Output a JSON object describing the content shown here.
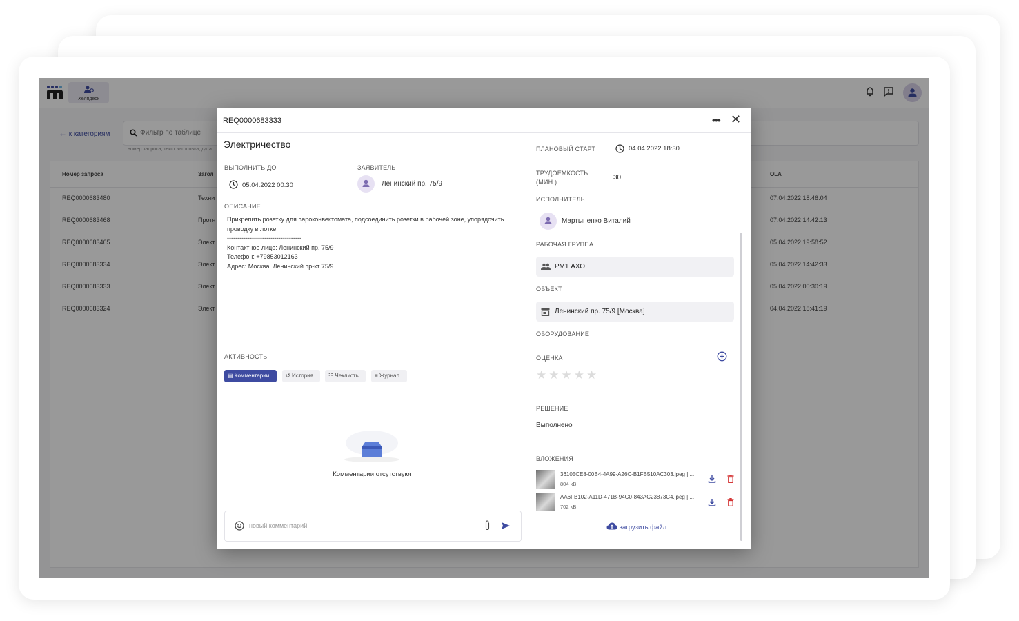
{
  "app": {
    "module_label": "Хелпдеск",
    "back_label": "к категориям",
    "filter_placeholder": "Фильтр по таблице",
    "filter_hint": "номер запроса, текст заголовка, дата",
    "accent_color": "#3e4ba1"
  },
  "table": {
    "columns": [
      "Номер запроса",
      "Загол",
      "OLA"
    ],
    "rows": [
      {
        "id": "REQ0000683480",
        "title": "Техни",
        "ola": "07.04.2022 18:46:04"
      },
      {
        "id": "REQ0000683468",
        "title": "Протя",
        "ola": "07.04.2022 14:42:13"
      },
      {
        "id": "REQ0000683465",
        "title": "Элект",
        "ola": "05.04.2022 19:58:52"
      },
      {
        "id": "REQ0000683334",
        "title": "Элект",
        "ola": "05.04.2022 14:42:33"
      },
      {
        "id": "REQ0000683333",
        "title": "Элект",
        "ola": "05.04.2022 00:30:19"
      },
      {
        "id": "REQ0000683324",
        "title": "Элект",
        "ola": "04.04.2022 18:41:19"
      }
    ]
  },
  "modal": {
    "title": "REQ0000683333",
    "category": "Электричество",
    "due_label": "ВЫПОЛНИТЬ ДО",
    "due_value": "05.04.2022 00:30",
    "requester_label": "ЗАЯВИТЕЛЬ",
    "requester_value": "Ленинский пр. 75/9",
    "description_label": "ОПИСАНИЕ",
    "description": "Прикрепить розетку для пароконвектомата, подсоединить розетки в рабочей зоне, упорядочить проводку в лотке.\n------------------------------------\nКонтактное лицо: Ленинский пр. 75/9\nТелефон: +79853012163\nАдрес: Москва. Ленинский пр-кт 75/9",
    "activity_label": "АКТИВНОСТЬ",
    "tabs": [
      "Комментарии",
      "История",
      "Чеклисты",
      "Журнал"
    ],
    "empty_comments": "Комментарии отсутствуют",
    "comment_placeholder": "новый комментарий",
    "planned_start_label": "ПЛАНОВЫЙ СТАРТ",
    "planned_start_value": "04.04.2022 18:30",
    "effort_label": "ТРУДОЕМКОСТЬ (МИН.)",
    "effort_value": "30",
    "assignee_label": "ИСПОЛНИТЕЛЬ",
    "assignee_value": "Мартыненко Виталий",
    "group_label": "РАБОЧАЯ ГРУППА",
    "group_value": "РМ1 АХО",
    "object_label": "ОБЪЕКТ",
    "object_value": "Ленинский пр. 75/9 [Москва]",
    "equipment_label": "ОБОРУДОВАНИЕ",
    "rating_label": "ОЦЕНКА",
    "rating_value": 0,
    "rating_max": 5,
    "solution_label": "РЕШЕНИЕ",
    "solution_value": "Выполнено",
    "attachments_label": "ВЛОЖЕНИЯ",
    "attachments": [
      {
        "name": "36105CE8-00B4-4A99-A26C-B1FB510AC303.jpeg | ...",
        "size": "804 kB"
      },
      {
        "name": "AA6FB102-A11D-471B-94C0-843AC23873C4.jpeg | ...",
        "size": "702 kB"
      }
    ],
    "upload_label": "загрузить файл"
  }
}
